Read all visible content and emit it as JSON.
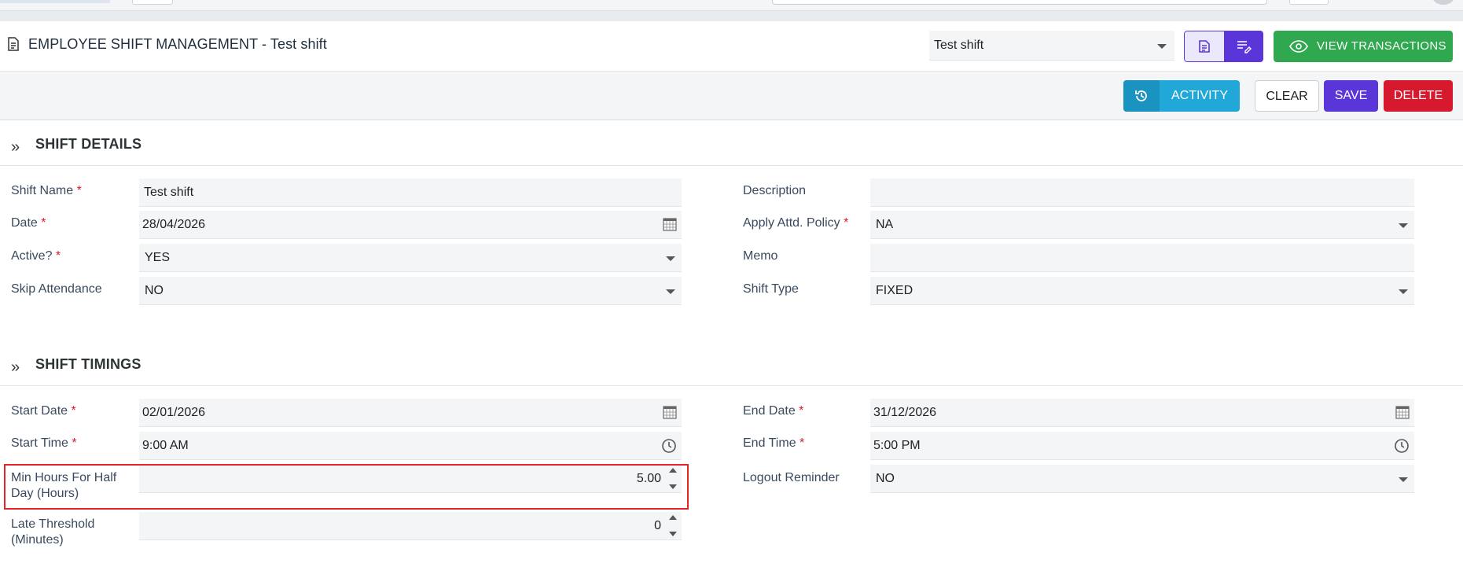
{
  "header": {
    "title": "EMPLOYEE SHIFT MANAGEMENT - Test shift",
    "record_select": "Test shift",
    "view_transactions": "VIEW TRANSACTIONS"
  },
  "actions": {
    "activity": "ACTIVITY",
    "clear": "CLEAR",
    "save": "SAVE",
    "delete": "DELETE"
  },
  "sections": {
    "details": "SHIFT DETAILS",
    "timings": "SHIFT TIMINGS"
  },
  "details": {
    "shift_name": {
      "label": "Shift Name",
      "value": "Test shift"
    },
    "date": {
      "label": "Date",
      "value": "28/04/2026"
    },
    "active": {
      "label": "Active?",
      "value": "YES"
    },
    "skip_attendance": {
      "label": "Skip Attendance",
      "value": "NO"
    },
    "description": {
      "label": "Description",
      "value": ""
    },
    "apply_policy": {
      "label": "Apply Attd. Policy",
      "value": "NA"
    },
    "memo": {
      "label": "Memo",
      "value": ""
    },
    "shift_type": {
      "label": "Shift Type",
      "value": "FIXED"
    }
  },
  "timings": {
    "start_date": {
      "label": "Start Date",
      "value": "02/01/2026"
    },
    "start_time": {
      "label": "Start Time",
      "value": "9:00 AM"
    },
    "min_hours_half_day": {
      "label_line1": "Min Hours For Half",
      "label_line2": "Day (Hours)",
      "value": "5.00"
    },
    "late_threshold": {
      "label_line1": "Late Threshold",
      "label_line2": "(Minutes)",
      "value": "0"
    },
    "end_date": {
      "label": "End Date",
      "value": "31/12/2026"
    },
    "end_time": {
      "label": "End Time",
      "value": "5:00 PM"
    },
    "logout_reminder": {
      "label": "Logout Reminder",
      "value": "NO"
    }
  },
  "required_marker": "*",
  "colors": {
    "primary": "#5a35d8",
    "success": "#2fa84f",
    "danger": "#d7192d",
    "info": "#21a7d8",
    "highlight": "#e5252a"
  },
  "icons": {
    "title": "document-icon",
    "chevron": "double-chevron-right-icon",
    "calendar": "calendar-icon",
    "clock": "clock-icon",
    "history": "history-icon",
    "eye": "eye-icon"
  }
}
